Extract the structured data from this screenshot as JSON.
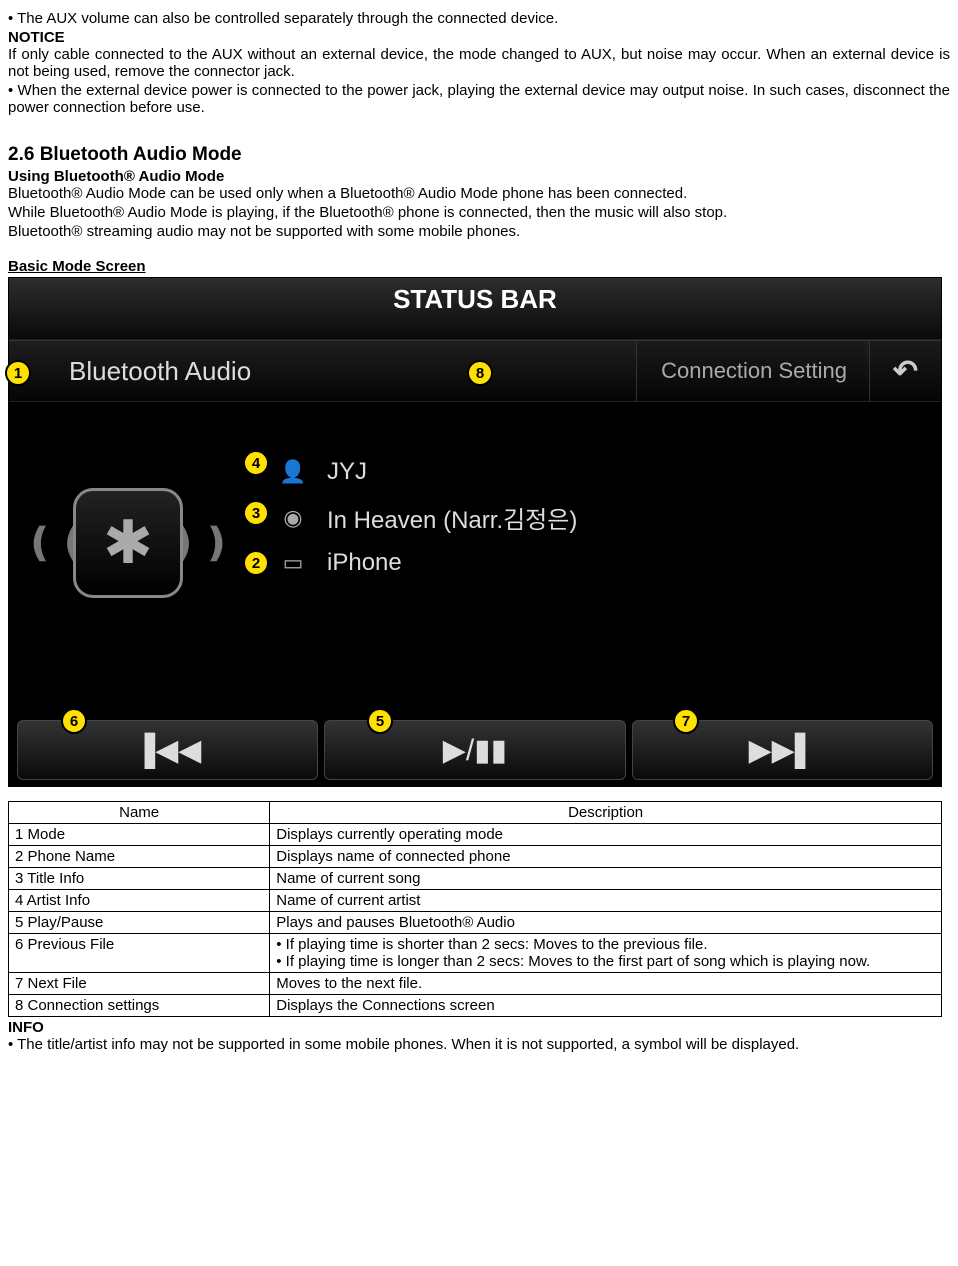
{
  "intro": {
    "bullet1": "• The AUX volume can also be controlled separately through the connected device.",
    "notice": "NOTICE",
    "p1": "If only cable connected to the AUX without an external device, the mode changed to AUX, but noise may occur. When an external device is not being used, remove the connector jack.",
    "p2": "• When the external device power is connected to the power jack, playing the external device may output noise. In such cases, disconnect the power connection before use."
  },
  "section": {
    "title": "2.6 Bluetooth Audio Mode",
    "sub": "Using Bluetooth® Audio Mode",
    "p1": "Bluetooth® Audio Mode can be used only when a Bluetooth® Audio Mode phone has been connected.",
    "p2": "While Bluetooth® Audio Mode is playing, if the Bluetooth® phone is connected, then the music will also stop.",
    "p3": "Bluetooth® streaming audio may not be supported with some mobile phones.",
    "basic": "Basic Mode Screen"
  },
  "screen": {
    "status": "STATUS BAR",
    "mode": "Bluetooth Audio",
    "conn": "Connection Setting",
    "back": "↶",
    "artist": "JYJ",
    "title": "In Heaven (Narr.김정은)",
    "phone": "iPhone",
    "prev": "▐◀◀",
    "play": "▶/▮▮",
    "next": "▶▶▌",
    "bt_symbol": "✱",
    "person": "👤",
    "disc": "◉",
    "device": "▭"
  },
  "callouts": {
    "c1": "1",
    "c2": "2",
    "c3": "3",
    "c4": "4",
    "c5": "5",
    "c6": "6",
    "c7": "7",
    "c8": "8"
  },
  "table": {
    "h_name": "Name",
    "h_desc": "Description",
    "rows": [
      {
        "name": "1 Mode",
        "desc": "Displays currently operating mode"
      },
      {
        "name": "2 Phone Name",
        "desc": "Displays name of connected phone"
      },
      {
        "name": "3 Title Info",
        "desc": "Name of current song"
      },
      {
        "name": "4 Artist Info",
        "desc": "Name of current artist"
      },
      {
        "name": "5 Play/Pause",
        "desc": "Plays and pauses Bluetooth® Audio"
      },
      {
        "name": "6 Previous File",
        "desc": "• If playing time is shorter than 2 secs: Moves to the previous file.\n• If playing time is longer than 2 secs: Moves to the first part of song which is playing now."
      },
      {
        "name": "7 Next File",
        "desc": "Moves to the next file."
      },
      {
        "name": "8 Connection settings",
        "desc": "Displays the Connections screen"
      }
    ]
  },
  "footer": {
    "info": "INFO",
    "p1": "• The title/artist info may not be supported in some mobile phones. When it is not supported, a symbol will be displayed."
  }
}
